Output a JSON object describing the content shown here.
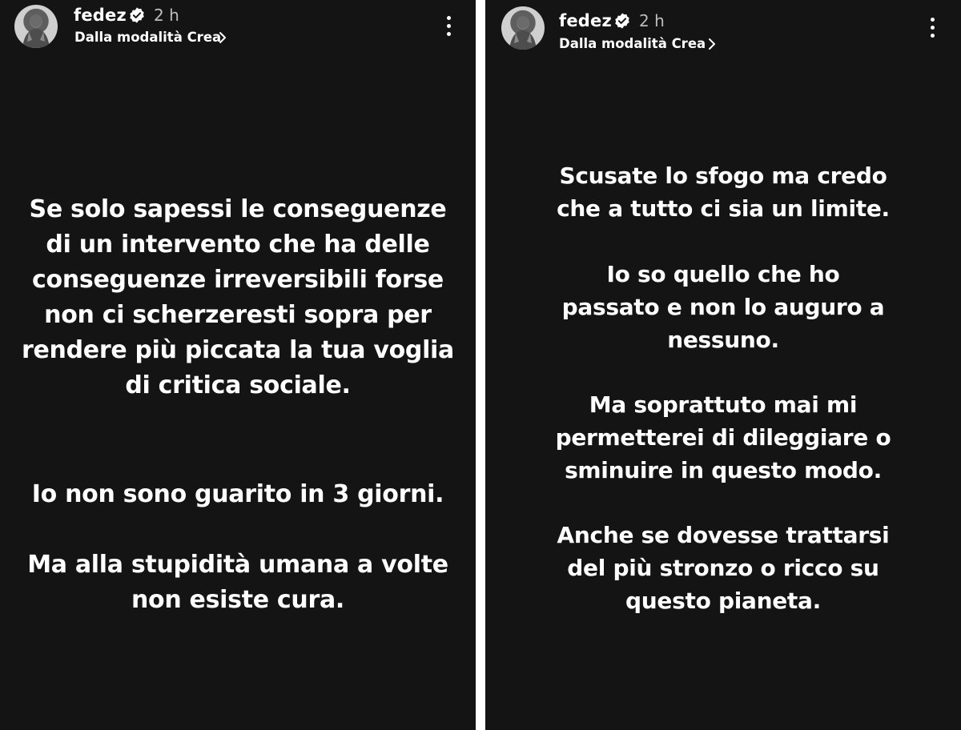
{
  "stories": [
    {
      "username": "fedez",
      "time": "2 h",
      "subtitle": "Dalla modalità Crea",
      "paragraphs": [
        [
          "Se solo sapessi le conseguenze",
          "di un intervento che ha delle",
          "conseguenze irreversibili forse",
          "non ci scherzeresti sopra per",
          "rendere più piccata la tua voglia",
          "di critica sociale."
        ],
        [
          "Io non sono guarito in 3 giorni."
        ],
        [
          "Ma alla stupidità umana a volte",
          "non esiste cura."
        ]
      ]
    },
    {
      "username": "fedez",
      "time": "2 h",
      "subtitle": "Dalla modalità Crea",
      "paragraphs": [
        [
          "Scusate lo sfogo ma credo",
          "che a tutto ci sia un limite."
        ],
        [
          "Io so quello che ho",
          "passato e non lo auguro a",
          "nessuno."
        ],
        [
          "Ma soprattuto mai mi",
          "permetterei di dileggiare o",
          "sminuire in questo modo."
        ],
        [
          "Anche se dovesse trattarsi",
          "del più stronzo o ricco su",
          "questo pianeta."
        ]
      ]
    }
  ],
  "icons": {
    "verified": "verified-badge-icon",
    "chevron": "chevron-right-icon",
    "more": "more-vertical-icon"
  },
  "colors": {
    "background": "#141414",
    "text": "#ffffff",
    "muted": "#bdbdbd"
  }
}
